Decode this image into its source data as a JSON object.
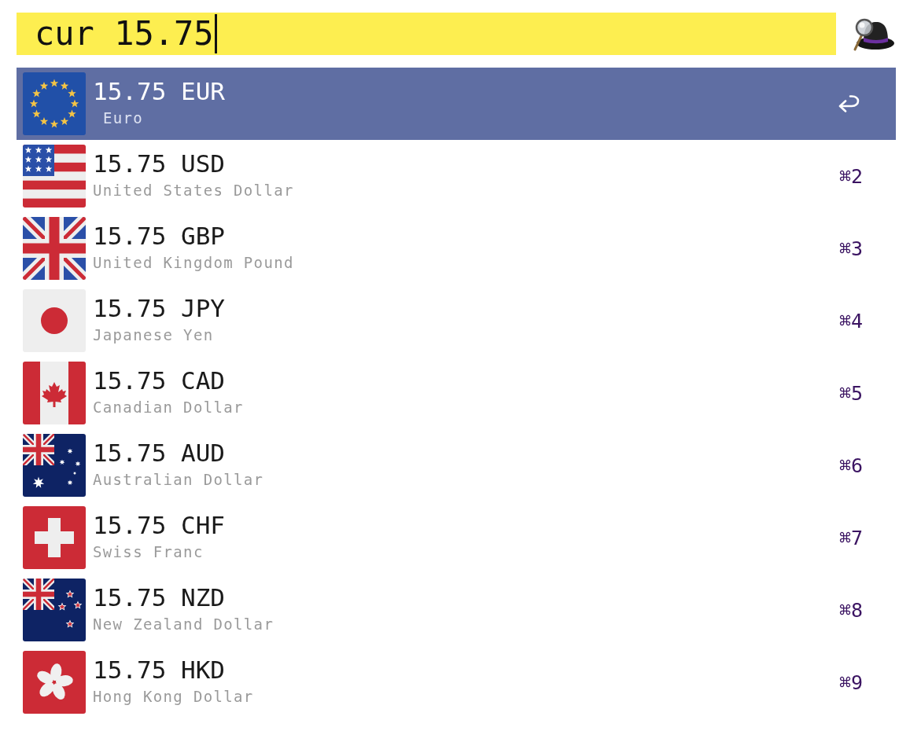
{
  "search": {
    "value": "cur 15.75"
  },
  "results": [
    {
      "title": "15.75 EUR",
      "subtitle": "Euro",
      "selected": true
    },
    {
      "title": "15.75 USD",
      "subtitle": "United States Dollar",
      "shortcut": "⌘2",
      "selected": false
    },
    {
      "title": "15.75 GBP",
      "subtitle": "United Kingdom Pound",
      "shortcut": "⌘3",
      "selected": false
    },
    {
      "title": "15.75 JPY",
      "subtitle": "Japanese Yen",
      "shortcut": "⌘4",
      "selected": false
    },
    {
      "title": "15.75 CAD",
      "subtitle": "Canadian Dollar",
      "shortcut": "⌘5",
      "selected": false
    },
    {
      "title": "15.75 AUD",
      "subtitle": "Australian Dollar",
      "shortcut": "⌘6",
      "selected": false
    },
    {
      "title": "15.75 CHF",
      "subtitle": "Swiss Franc",
      "shortcut": "⌘7",
      "selected": false
    },
    {
      "title": "15.75 NZD",
      "subtitle": "New Zealand Dollar",
      "shortcut": "⌘8",
      "selected": false
    },
    {
      "title": "15.75 HKD",
      "subtitle": "Hong Kong Dollar",
      "shortcut": "⌘9",
      "selected": false
    }
  ]
}
